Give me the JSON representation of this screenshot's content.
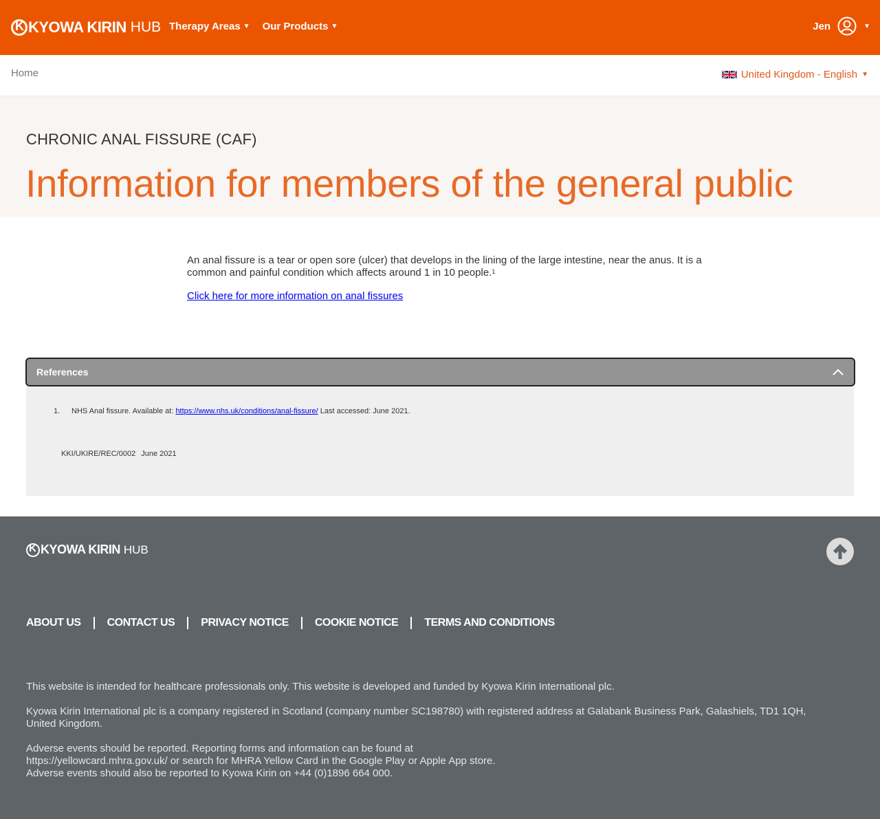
{
  "header": {
    "logo_brand": "KYOWA KIRIN",
    "logo_hub": "HUB",
    "nav": [
      {
        "label": "Therapy Areas"
      },
      {
        "label": "Our Products"
      }
    ],
    "user_name": "Jen"
  },
  "subbar": {
    "breadcrumb": "Home",
    "locale": "United Kingdom - English"
  },
  "hero": {
    "kicker": "CHRONIC ANAL FISSURE (CAF)",
    "title": "Information for members of the general public"
  },
  "content": {
    "paragraph": "An anal fissure is a tear or open sore (ulcer) that develops in the lining of the large intestine, near the anus. It is a common and painful condition which affects around 1 in 10 people.",
    "sup": "1",
    "link": "Click here for more information on anal fissures"
  },
  "references": {
    "title": "References",
    "items": [
      {
        "num": "1.",
        "prefix": "NHS Anal fissure. Available at: ",
        "url": "https://www.nhs.uk/conditions/anal-fissure/",
        "suffix": " Last accessed: June 2021."
      }
    ],
    "code": "KKI/UKIRE/REC/0002",
    "date": "June 2021"
  },
  "footer": {
    "logo_brand": "KYOWA KIRIN",
    "logo_hub": "HUB",
    "links": [
      "ABOUT US",
      "CONTACT US",
      "PRIVACY NOTICE",
      "COOKIE NOTICE",
      "TERMS AND CONDITIONS"
    ],
    "text1": "This website is intended for healthcare professionals only. This website is developed and funded by Kyowa Kirin International plc.",
    "text2": "Kyowa Kirin International plc is a company registered in Scotland (company number SC198780) with registered address at Galabank Business Park, Galashiels, TD1 1QH, United Kingdom.",
    "text3a": "Adverse events should be reported. Reporting forms and information can be found at",
    "text3b": "https://yellowcard.mhra.gov.uk/ or search for MHRA Yellow Card in the Google Play or Apple App store.",
    "text3c": "Adverse events should also be reported to Kyowa Kirin on +44 (0)1896 664 000."
  },
  "colors": {
    "brand_orange": "#eb5500",
    "title_orange": "#e86a27",
    "footer_grey": "#5f6468"
  },
  "icons": {
    "user": "user-circle-icon",
    "flag": "uk-flag-icon",
    "collapse": "chevron-up-icon",
    "to_top": "arrow-up-icon"
  }
}
